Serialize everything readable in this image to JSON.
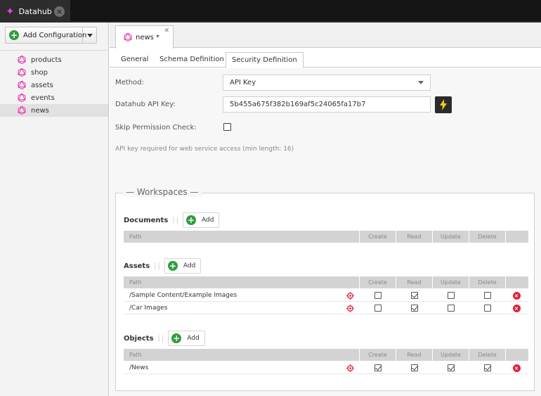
{
  "app": {
    "title": "Datahub"
  },
  "sidebar": {
    "add_label": "Add Configuration",
    "items": [
      {
        "label": "products"
      },
      {
        "label": "shop"
      },
      {
        "label": "assets"
      },
      {
        "label": "events"
      },
      {
        "label": "news",
        "selected": true
      }
    ]
  },
  "doc_tab": {
    "label": "news *"
  },
  "tabs": [
    {
      "label": "General"
    },
    {
      "label": "Schema Definition"
    },
    {
      "label": "Security Definition",
      "active": true
    }
  ],
  "form": {
    "method_label": "Method:",
    "method_value": "API Key",
    "apikey_label": "Datahub API Key:",
    "apikey_value": "5b455a675f382b169af5c24065fa17b7",
    "skip_label": "Skip Permission Check:",
    "skip_checked": false,
    "hint": "API key required for web service access (min length: 16)"
  },
  "workspaces": {
    "legend": "Workspaces",
    "add_label": "Add",
    "columns": {
      "path": "Path",
      "create": "Create",
      "read": "Read",
      "update": "Update",
      "delete": "Delete"
    },
    "documents": {
      "title": "Documents",
      "rows": []
    },
    "assets": {
      "title": "Assets",
      "rows": [
        {
          "path": "/Sample Content/Example Images",
          "create": false,
          "read": true,
          "update": false,
          "delete": false
        },
        {
          "path": "/Car Images",
          "create": false,
          "read": true,
          "update": false,
          "delete": false
        }
      ]
    },
    "objects": {
      "title": "Objects",
      "rows": [
        {
          "path": "/News",
          "create": true,
          "read": true,
          "update": true,
          "delete": true
        }
      ]
    }
  },
  "colors": {
    "accent_green": "#2e9e3b",
    "delete_red": "#e0203a",
    "graphql_pink": "#e535ab"
  },
  "icons": [
    "sparkle-icon",
    "graphql-icon",
    "bolt-icon",
    "target-icon",
    "delete-icon",
    "plus-icon"
  ]
}
